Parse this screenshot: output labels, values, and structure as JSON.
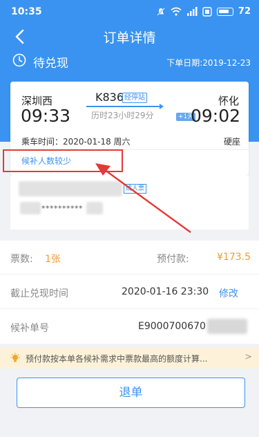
{
  "status_bar": {
    "time": "10:35",
    "battery": "72",
    "icons": [
      "mute-icon",
      "wifi-icon",
      "signal-icon",
      "hd-icon",
      "battery-icon"
    ]
  },
  "nav": {
    "title": "订单详情",
    "back_icon": "back-arrow-icon"
  },
  "order_status": {
    "text": "待兑现",
    "order_date": "下单日期:2019-12-23"
  },
  "ticket": {
    "from_station": "深圳西",
    "departure_time": "09:33",
    "train_number": "K836",
    "stops_label": "经停站",
    "duration": "历时23小时29分",
    "to_station": "怀化",
    "arrival_time": "09:02",
    "next_day_badge": "+1天",
    "ride_date": "乘车时间：2020-01-18 周六",
    "seat_type": "硬座",
    "waitlist_note": "候补人数较少"
  },
  "passenger": {
    "type_badge": "成人票",
    "id_number": "**********"
  },
  "info": {
    "tickets_label": "票数:",
    "tickets_value": "1张",
    "prepay_label": "预付款:",
    "prepay_value": "¥173.5",
    "deadline_label": "截止兑现时间",
    "deadline_value": "2020-01-16 23:30",
    "modify_label": "修改",
    "order_no_label": "候补单号",
    "order_no_value": "E9000700670"
  },
  "notice": {
    "text": "预付款按本单各候补需求中票款最高的额度计算..."
  },
  "actions": {
    "refund_label": "退单"
  },
  "colors": {
    "brand_blue": "#3a93f0",
    "accent_orange": "#f29b2e",
    "annotation_red": "#e53935"
  }
}
